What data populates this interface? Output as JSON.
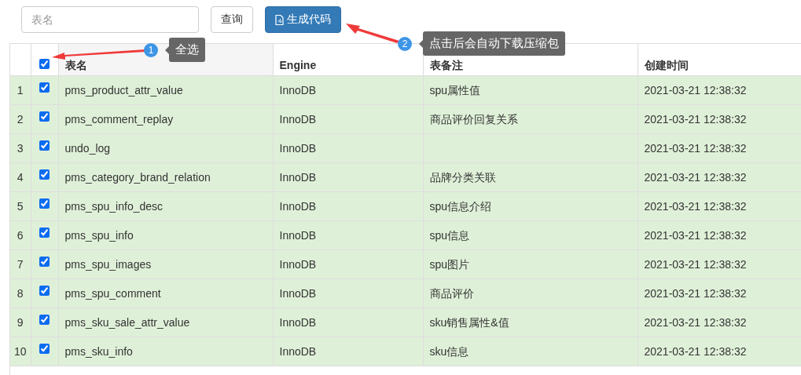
{
  "search": {
    "placeholder": "表名"
  },
  "buttons": [
    {
      "kind": "plain",
      "label": "查询"
    },
    {
      "kind": "primary",
      "label": "生成代码"
    }
  ],
  "table": {
    "select_all": {
      "checked": true
    },
    "columns": [
      "表名",
      "Engine",
      "表备注",
      "创建时间"
    ],
    "rows": [
      {
        "index": "1",
        "selected": true,
        "checked": true,
        "cells": [
          "pms_product_attr_value",
          "InnoDB",
          "spu属性值",
          "2021-03-21 12:38:32"
        ]
      },
      {
        "index": "2",
        "selected": true,
        "checked": true,
        "cells": [
          "pms_comment_replay",
          "InnoDB",
          "商品评价回复关系",
          "2021-03-21 12:38:32"
        ]
      },
      {
        "index": "3",
        "selected": true,
        "checked": true,
        "cells": [
          "undo_log",
          "InnoDB",
          "",
          "2021-03-21 12:38:32"
        ]
      },
      {
        "index": "4",
        "selected": true,
        "checked": true,
        "cells": [
          "pms_category_brand_relation",
          "InnoDB",
          "品牌分类关联",
          "2021-03-21 12:38:32"
        ]
      },
      {
        "index": "5",
        "selected": true,
        "checked": true,
        "cells": [
          "pms_spu_info_desc",
          "InnoDB",
          "spu信息介绍",
          "2021-03-21 12:38:32"
        ]
      },
      {
        "index": "6",
        "selected": true,
        "checked": true,
        "cells": [
          "pms_spu_info",
          "InnoDB",
          "spu信息",
          "2021-03-21 12:38:32"
        ]
      },
      {
        "index": "7",
        "selected": true,
        "checked": true,
        "cells": [
          "pms_spu_images",
          "InnoDB",
          "spu图片",
          "2021-03-21 12:38:32"
        ]
      },
      {
        "index": "8",
        "selected": true,
        "checked": true,
        "cells": [
          "pms_spu_comment",
          "InnoDB",
          "商品评价",
          "2021-03-21 12:38:32"
        ]
      },
      {
        "index": "9",
        "selected": true,
        "checked": true,
        "cells": [
          "pms_sku_sale_attr_value",
          "InnoDB",
          "sku销售属性&值",
          "2021-03-21 12:38:32"
        ]
      },
      {
        "index": "10",
        "selected": true,
        "checked": true,
        "cells": [
          "pms_sku_info",
          "InnoDB",
          "sku信息",
          "2021-03-21 12:38:32"
        ]
      }
    ]
  },
  "annotations": [
    {
      "number": "1",
      "text": "全选"
    },
    {
      "number": "2",
      "text": "点击后会自动下载压缩包"
    }
  ]
}
